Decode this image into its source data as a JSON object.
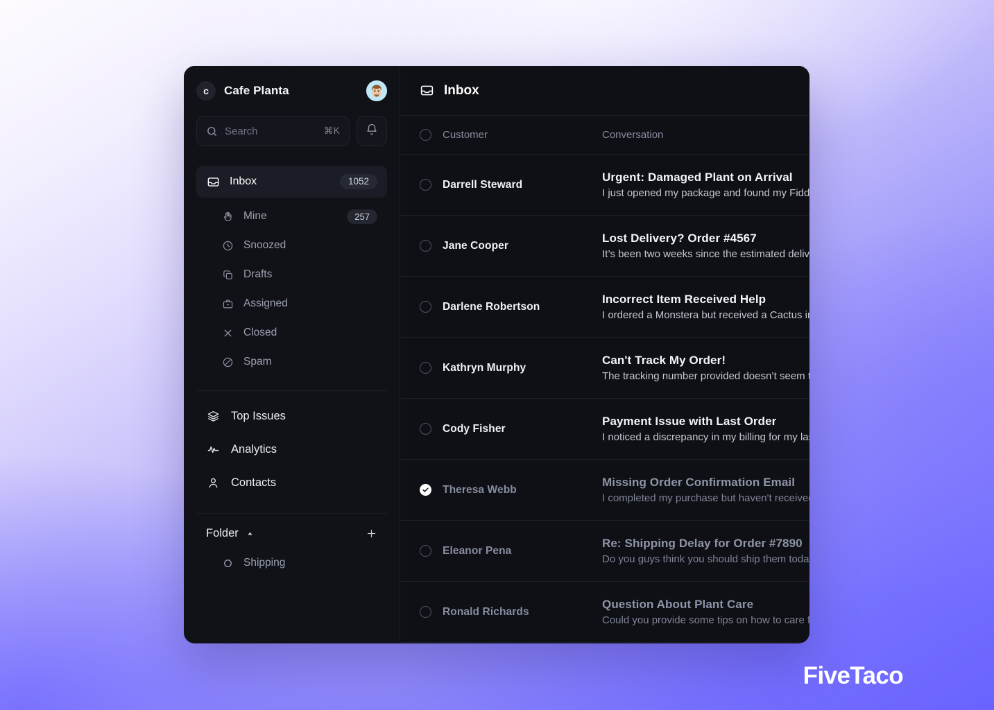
{
  "brand": {
    "logo_letter": "c",
    "name": "Cafe Planta",
    "avatar_name": "user-avatar"
  },
  "search": {
    "placeholder": "Search",
    "shortcut": "⌘K"
  },
  "sidebar": {
    "primary": {
      "label": "Inbox",
      "badge": "1052",
      "icon": "inbox-icon"
    },
    "sub_items": [
      {
        "label": "Mine",
        "badge": "257",
        "icon": "hand-icon"
      },
      {
        "label": "Snoozed",
        "badge": "",
        "icon": "clock-icon"
      },
      {
        "label": "Drafts",
        "badge": "",
        "icon": "copy-icon"
      },
      {
        "label": "Assigned",
        "badge": "",
        "icon": "briefcase-icon"
      },
      {
        "label": "Closed",
        "badge": "",
        "icon": "x-icon"
      },
      {
        "label": "Spam",
        "badge": "",
        "icon": "ban-icon"
      }
    ],
    "secondary": [
      {
        "label": "Top Issues",
        "icon": "layers-icon"
      },
      {
        "label": "Analytics",
        "icon": "activity-icon"
      },
      {
        "label": "Contacts",
        "icon": "person-icon"
      }
    ],
    "folder": {
      "label": "Folder",
      "add_label": "+",
      "items": [
        {
          "label": "Shipping",
          "icon": "circle-icon"
        }
      ]
    }
  },
  "main": {
    "title": "Inbox",
    "title_icon": "inbox-icon",
    "columns": {
      "customer": "Customer",
      "conversation": "Conversation"
    },
    "rows": [
      {
        "customer": "Darrell Steward",
        "subject": "Urgent: Damaged Plant on Arrival",
        "preview": "I just opened my package and found my Fiddle Leaf Fig",
        "read": false,
        "selected": false
      },
      {
        "customer": "Jane Cooper",
        "subject": "Lost Delivery? Order #4567",
        "preview": "It’s been two weeks since the estimated delivery date",
        "read": false,
        "selected": false
      },
      {
        "customer": "Darlene Robertson",
        "subject": "Incorrect Item Received Help",
        "preview": "I ordered a Monstera but received a Cactus instead",
        "read": false,
        "selected": false
      },
      {
        "customer": "Kathryn Murphy",
        "subject": "Can't Track My Order!",
        "preview": "The tracking number provided doesn’t seem to work",
        "read": false,
        "selected": false
      },
      {
        "customer": "Cody Fisher",
        "subject": "Payment Issue with Last Order",
        "preview": "I noticed a discrepancy in my billing for my last order",
        "read": false,
        "selected": false
      },
      {
        "customer": "Theresa Webb",
        "subject": "Missing Order Confirmation Email",
        "preview": "I completed my purchase but haven't received anything",
        "read": true,
        "selected": true
      },
      {
        "customer": "Eleanor Pena",
        "subject": "Re: Shipping Delay for Order #7890",
        "preview": "Do you guys think you should ship them today?",
        "read": true,
        "selected": false
      },
      {
        "customer": "Ronald Richards",
        "subject": "Question About Plant Care",
        "preview": "Could you provide some tips on how to care for",
        "read": true,
        "selected": false
      }
    ]
  },
  "watermark": {
    "text": "FiveTaco"
  },
  "colors": {
    "card_bg": "#0e0f13",
    "sidebar_bg": "#111218",
    "accent_purple": "#6a62ff",
    "text_primary": "#f3f4f8",
    "text_muted": "#8d93a3"
  }
}
